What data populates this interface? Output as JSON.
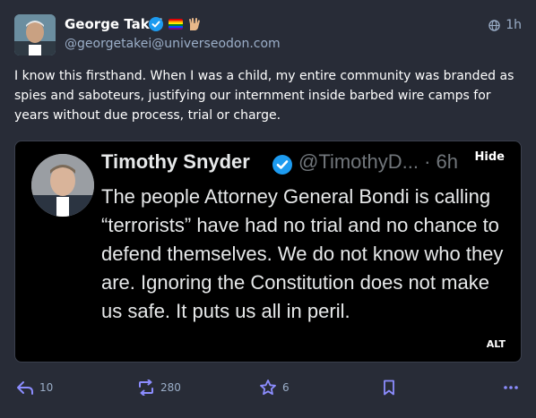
{
  "author": {
    "display_name": "George Takei",
    "handle": "@georgetakei@universeodon.com"
  },
  "meta": {
    "timestamp": "1h"
  },
  "post": {
    "text": "I know this firsthand. When I was a child, my entire community was branded as spies and saboteurs, justifying our internment inside barbed wire camps for years without due process, trial or charge."
  },
  "media": {
    "embedded_tweet": {
      "name": "Timothy Snyder",
      "handle_time": "@TimothyD... · 6h",
      "body": "The people Attorney General Bondi is calling “terrorists” have had no trial and no chance to defend themselves. We do not know who they are. Ignoring the Constitution does not make us safe. It puts us all in peril."
    },
    "hide_label": "Hide",
    "alt_label": "ALT"
  },
  "actions": {
    "replies": "10",
    "boosts": "280",
    "favourites": "6"
  },
  "icons": {
    "verified": "verified-check-icon",
    "flag": "rainbow-flag-icon",
    "vulcan": "vulcan-salute-icon",
    "visibility": "globe-icon",
    "reply": "reply-icon",
    "boost": "boost-icon",
    "favourite": "star-icon",
    "bookmark": "bookmark-icon",
    "more": "more-icon"
  },
  "colors": {
    "background": "#282c37",
    "accent": "#8c8dff",
    "muted": "#9baec8",
    "verified": "#1d9bf0"
  }
}
